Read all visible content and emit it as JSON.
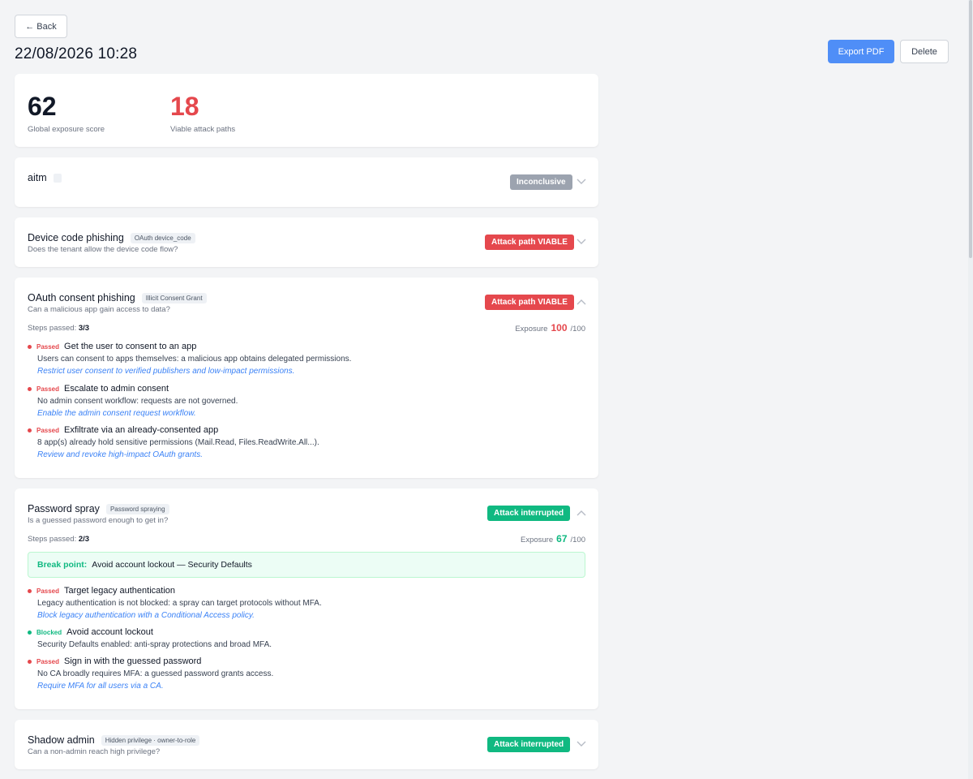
{
  "header": {
    "back_label": "← Back",
    "title": "22/08/2026 10:28",
    "export_label": "Export PDF",
    "delete_label": "Delete"
  },
  "summary": {
    "score": "62",
    "score_label": "Global exposure score",
    "paths": "18",
    "paths_label": "Viable attack paths"
  },
  "scenarios": {
    "aitm": {
      "title": "aitm",
      "badge": "Inconclusive"
    },
    "device": {
      "title": "Device code phishing",
      "tag": "OAuth device_code",
      "subtitle": "Does the tenant allow the device code flow?",
      "badge": "Attack path VIABLE"
    },
    "oauth": {
      "title": "OAuth consent phishing",
      "tag": "Illicit Consent Grant",
      "subtitle": "Can a malicious app gain access to data?",
      "badge": "Attack path VIABLE",
      "steps_label": "Steps passed:",
      "steps_value": "3/3",
      "exposure_label": "Exposure",
      "exposure_value": "100",
      "exposure_max": "/100",
      "steps": [
        {
          "status": "Passed",
          "title": "Get the user to consent to an app",
          "desc": "Users can consent to apps themselves: a malicious app obtains delegated permissions.",
          "link": "Restrict user consent to verified publishers and low-impact permissions."
        },
        {
          "status": "Passed",
          "title": "Escalate to admin consent",
          "desc": "No admin consent workflow: requests are not governed.",
          "link": "Enable the admin consent request workflow."
        },
        {
          "status": "Passed",
          "title": "Exfiltrate via an already-consented app",
          "desc": "8 app(s) already hold sensitive permissions (Mail.Read, Files.ReadWrite.All...).",
          "link": "Review and revoke high-impact OAuth grants."
        }
      ]
    },
    "spray": {
      "title": "Password spray",
      "tag": "Password spraying",
      "subtitle": "Is a guessed password enough to get in?",
      "badge": "Attack interrupted",
      "steps_label": "Steps passed:",
      "steps_value": "2/3",
      "exposure_label": "Exposure",
      "exposure_value": "67",
      "exposure_max": "/100",
      "breakpoint_label": "Break point:",
      "breakpoint_text": "Avoid account lockout — Security Defaults",
      "steps": [
        {
          "status": "Passed",
          "title": "Target legacy authentication",
          "desc": "Legacy authentication is not blocked: a spray can target protocols without MFA.",
          "link": "Block legacy authentication with a Conditional Access policy."
        },
        {
          "status": "Blocked",
          "title": "Avoid account lockout",
          "desc": "Security Defaults enabled: anti-spray protections and broad MFA."
        },
        {
          "status": "Passed",
          "title": "Sign in with the guessed password",
          "desc": "No CA broadly requires MFA: a guessed password grants access.",
          "link": "Require MFA for all users via a CA."
        }
      ]
    },
    "shadow": {
      "title": "Shadow admin",
      "tag": "Hidden privilege · owner-to-role",
      "subtitle": "Can a non-admin reach high privilege?",
      "badge": "Attack interrupted"
    }
  },
  "colors": {
    "accent": "#4f8ef7",
    "viable": "#e5484d",
    "interrupted": "#10b981",
    "inconclusive": "#9ca3af"
  },
  "icons": {
    "chevron_down": "chevron-down-icon",
    "chevron_up": "chevron-up-icon"
  }
}
